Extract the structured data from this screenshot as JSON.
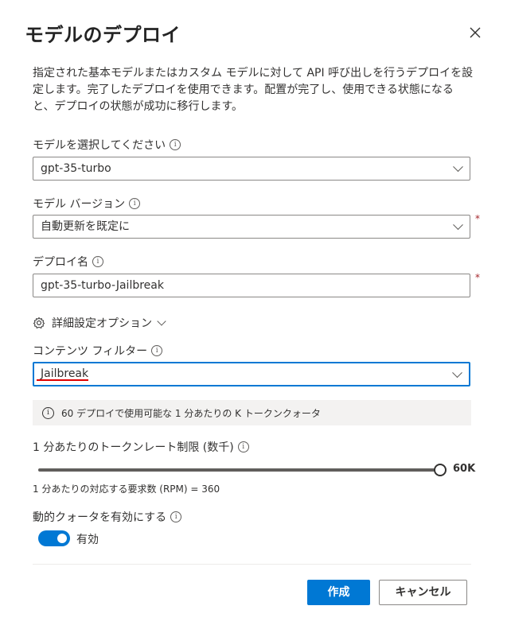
{
  "dialog": {
    "title": "モデルのデプロイ",
    "description": "指定された基本モデルまたはカスタム モデルに対して API 呼び出しを行うデプロイを設定します。完了したデプロイを使用できます。配置が完了し、使用できる状態になると、デプロイの状態が成功に移行します。"
  },
  "model_select": {
    "label": "モデルを選択してください",
    "value": "gpt-35-turbo"
  },
  "model_version": {
    "label": "モデル バージョン",
    "value": "自動更新を既定に",
    "required_mark": "*"
  },
  "deployment_name": {
    "label": "デプロイ名",
    "value": "gpt-35-turbo-Jailbreak",
    "required_mark": "*"
  },
  "advanced": {
    "label": "詳細設定オプション"
  },
  "content_filter": {
    "label": "コンテンツ フィルター",
    "value": "Jailbreak"
  },
  "quota_info": {
    "text": "60 デプロイで使用可能な 1 分あたりの K トークンクォータ"
  },
  "rate_limit": {
    "label": "1 分あたりのトークンレート制限 (数千)",
    "value_text": "60K",
    "fraction": 1.0
  },
  "rpm": {
    "text": "1 分あたりの対応する要求数 (RPM) = 360"
  },
  "dynamic_quota": {
    "label": "動的クォータを有効にする",
    "state_label": "有効",
    "enabled": true
  },
  "buttons": {
    "create": "作成",
    "cancel": "キャンセル"
  },
  "icons": {
    "info": "i",
    "close": "close-icon",
    "gear": "gear-icon"
  },
  "colors": {
    "accent": "#0078d4",
    "required": "#a4262c",
    "highlight_underline": "#e00000"
  }
}
